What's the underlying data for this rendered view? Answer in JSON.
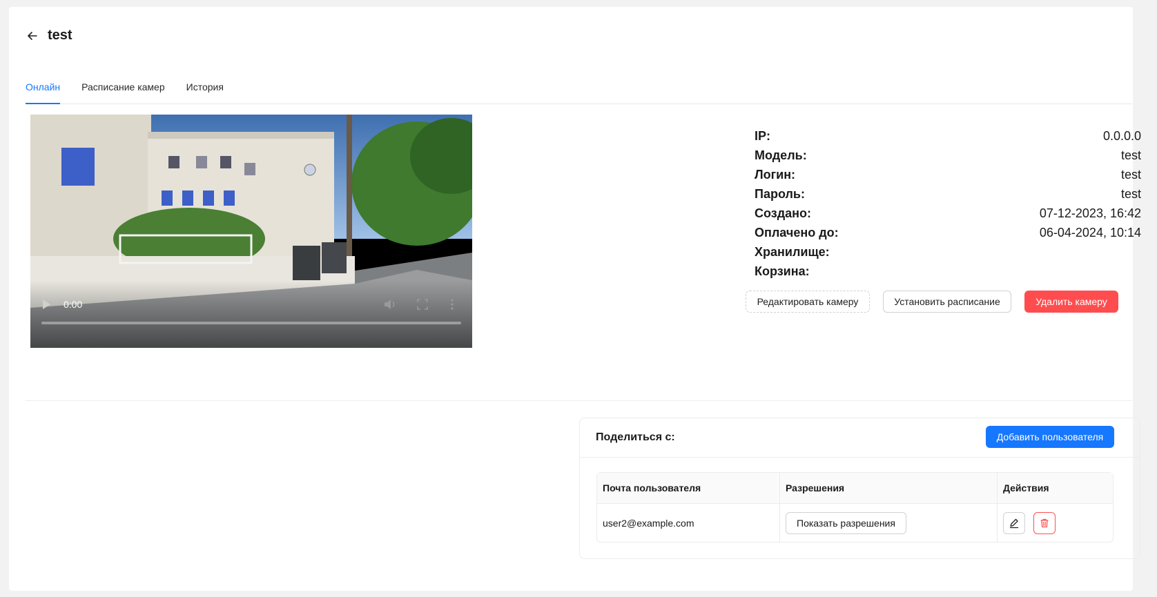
{
  "header": {
    "title": "test",
    "back_icon": "arrow-left-icon"
  },
  "tabs": [
    {
      "label": "Онлайн",
      "active": true
    },
    {
      "label": "Расписание камер",
      "active": false
    },
    {
      "label": "История",
      "active": false
    }
  ],
  "player": {
    "time": "0:00",
    "progress": 0
  },
  "camera_info": [
    {
      "label": "IP:",
      "value": "0.0.0.0"
    },
    {
      "label": "Модель:",
      "value": "test"
    },
    {
      "label": "Логин:",
      "value": "test"
    },
    {
      "label": "Пароль:",
      "value": "test"
    },
    {
      "label": "Создано:",
      "value": "07-12-2023, 16:42"
    },
    {
      "label": "Оплачено до:",
      "value": "06-04-2024, 10:14"
    },
    {
      "label": "Хранилище:",
      "value": ""
    },
    {
      "label": "Корзина:",
      "value": ""
    }
  ],
  "actions": {
    "edit_label": "Редактировать камеру",
    "schedule_label": "Установить расписание",
    "delete_label": "Удалить камеру"
  },
  "share": {
    "title": "Поделиться с:",
    "add_label": "Добавить пользователя",
    "columns": [
      "Почта пользователя",
      "Разрешения",
      "Действия"
    ],
    "rows": [
      {
        "email": "user2@example.com",
        "permissions_label": "Показать разрешения"
      }
    ]
  },
  "colors": {
    "accent": "#1677ff",
    "danger": "#ff4d4f"
  }
}
